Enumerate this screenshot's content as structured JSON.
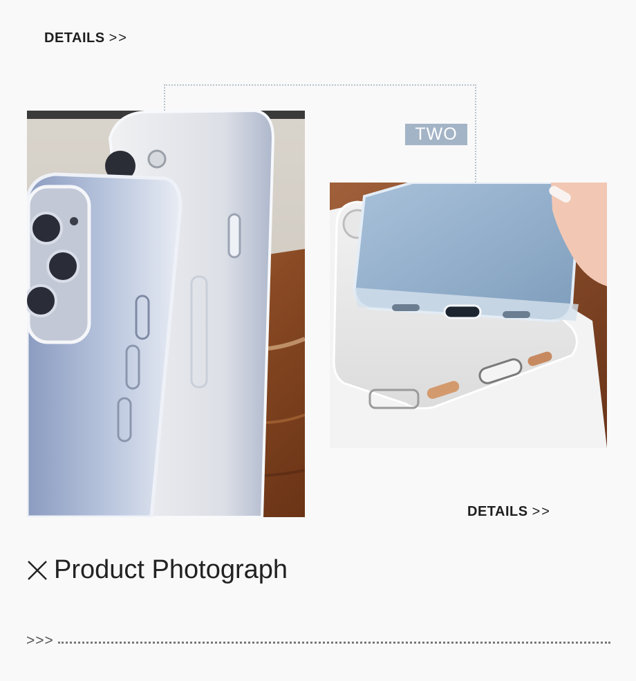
{
  "top_link": {
    "label": "DETAILS",
    "arrow": ">>"
  },
  "badge": {
    "label": "TWO"
  },
  "bottom_link": {
    "label": "DETAILS",
    "arrow": ">>"
  },
  "caption": {
    "icon": "close-x-icon",
    "text": "Product Photograph"
  },
  "footer": {
    "arrow": ">>>"
  },
  "colors": {
    "badge_bg": "#a3b4c6",
    "frame_line": "#b8c2cb",
    "page_bg": "#f9f9f9"
  }
}
